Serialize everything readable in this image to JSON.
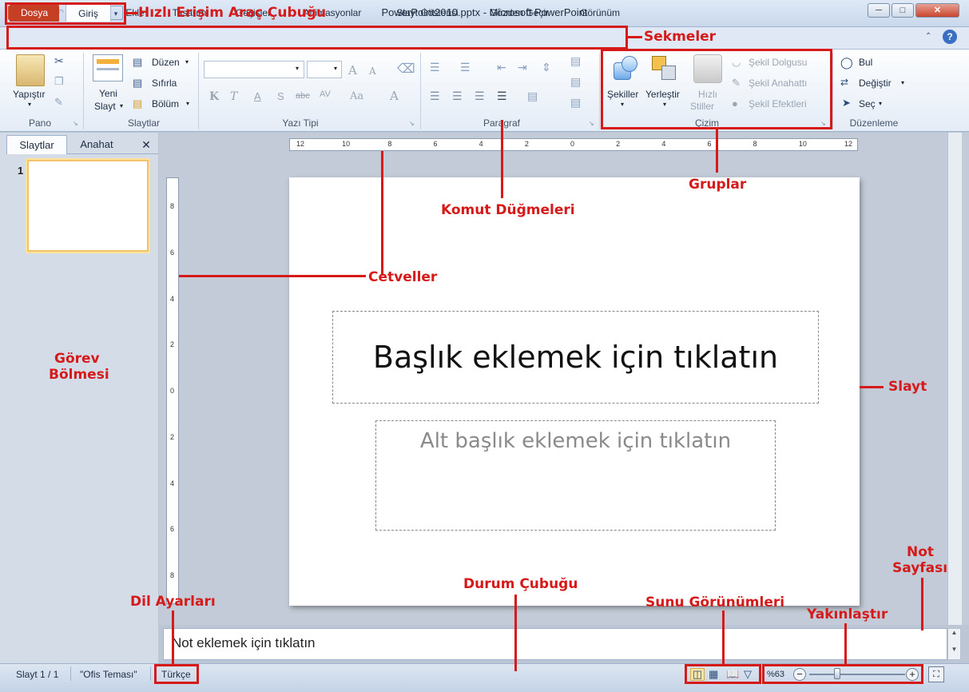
{
  "window": {
    "title": "PowerPoint2010.pptx - Microsoft PowerPoint",
    "app_logo": "P",
    "controls": [
      "minimize-icon",
      "maximize-icon",
      "close-icon"
    ]
  },
  "quick_access": {
    "icons": [
      "save-icon",
      "undo-icon",
      "redo-icon",
      "customize-icon"
    ]
  },
  "tabs": [
    "Dosya",
    "Giriş",
    "Ekle",
    "Tasarım",
    "Geçişler",
    "Animasyonlar",
    "Slayt Gösterisi",
    "Gözden Geçir",
    "Görünüm"
  ],
  "ribbon": {
    "groups": {
      "pano": "Pano",
      "slaytlar": "Slaytlar",
      "yazi_tipi": "Yazı Tipi",
      "paragraf": "Paragraf",
      "cizim": "Çizim",
      "duzenleme": "Düzenleme"
    },
    "pano": {
      "paste": "Yapıştır"
    },
    "slaytlar": {
      "new_slide_1": "Yeni",
      "new_slide_2": "Slayt",
      "layout": "Düzen",
      "reset": "Sıfırla",
      "section": "Bölüm"
    },
    "yazi_tipi": {
      "bold": "K",
      "italic": "T",
      "underline": "A",
      "shadow": "S",
      "strike": "abc",
      "spacing": "AV",
      "case": "Aa",
      "color": "A",
      "grow": "A",
      "shrink": "A"
    },
    "cizim": {
      "shapes": "Şekiller",
      "arrange": "Yerleştir",
      "quick_styles_1": "Hızlı",
      "quick_styles_2": "Stiller",
      "fill": "Şekil Dolgusu",
      "outline": "Şekil Anahattı",
      "effects": "Şekil Efektleri"
    },
    "duzenleme": {
      "find": "Bul",
      "replace": "Değiştir",
      "select": "Seç"
    }
  },
  "left_pane": {
    "tabs": [
      "Slaytlar",
      "Anahat"
    ],
    "close": "✕",
    "slide_number": "1"
  },
  "rulers": {
    "horizontal_labels": [
      "12",
      "10",
      "8",
      "6",
      "4",
      "2",
      "0",
      "2",
      "4",
      "6",
      "8",
      "10",
      "12"
    ],
    "vertical_labels": [
      "8",
      "6",
      "4",
      "2",
      "0",
      "2",
      "4",
      "6",
      "8"
    ]
  },
  "slide": {
    "title_placeholder": "Başlık eklemek için tıklatın",
    "subtitle_placeholder": "Alt başlık eklemek için tıklatın"
  },
  "notes": {
    "placeholder": "Not eklemek için tıklatın"
  },
  "status": {
    "slide_info": "Slayt 1 / 1",
    "theme": "\"Ofis Teması\"",
    "language": "Türkçe",
    "zoom": "%63",
    "zoom_level_percent": 63
  },
  "annotations": {
    "quick_access": "Hızlı Erişim Araç Çubuğu",
    "tabs": "Sekmeler",
    "groups": "Gruplar",
    "command_buttons": "Komut Düğmeleri",
    "rulers": "Cetveller",
    "task_pane_1": "Görev",
    "task_pane_2": "Bölmesi",
    "slide": "Slayt",
    "notes_page_1": "Not",
    "notes_page_2": "Sayfası",
    "zoom": "Yakınlaştır",
    "views": "Sunu Görünümleri",
    "status_bar": "Durum Çubuğu",
    "language": "Dil Ayarları"
  },
  "colors": {
    "annotation": "#d61a1a",
    "file_tab": "#c53f25",
    "thumb_highlight": "#f3c36b"
  }
}
